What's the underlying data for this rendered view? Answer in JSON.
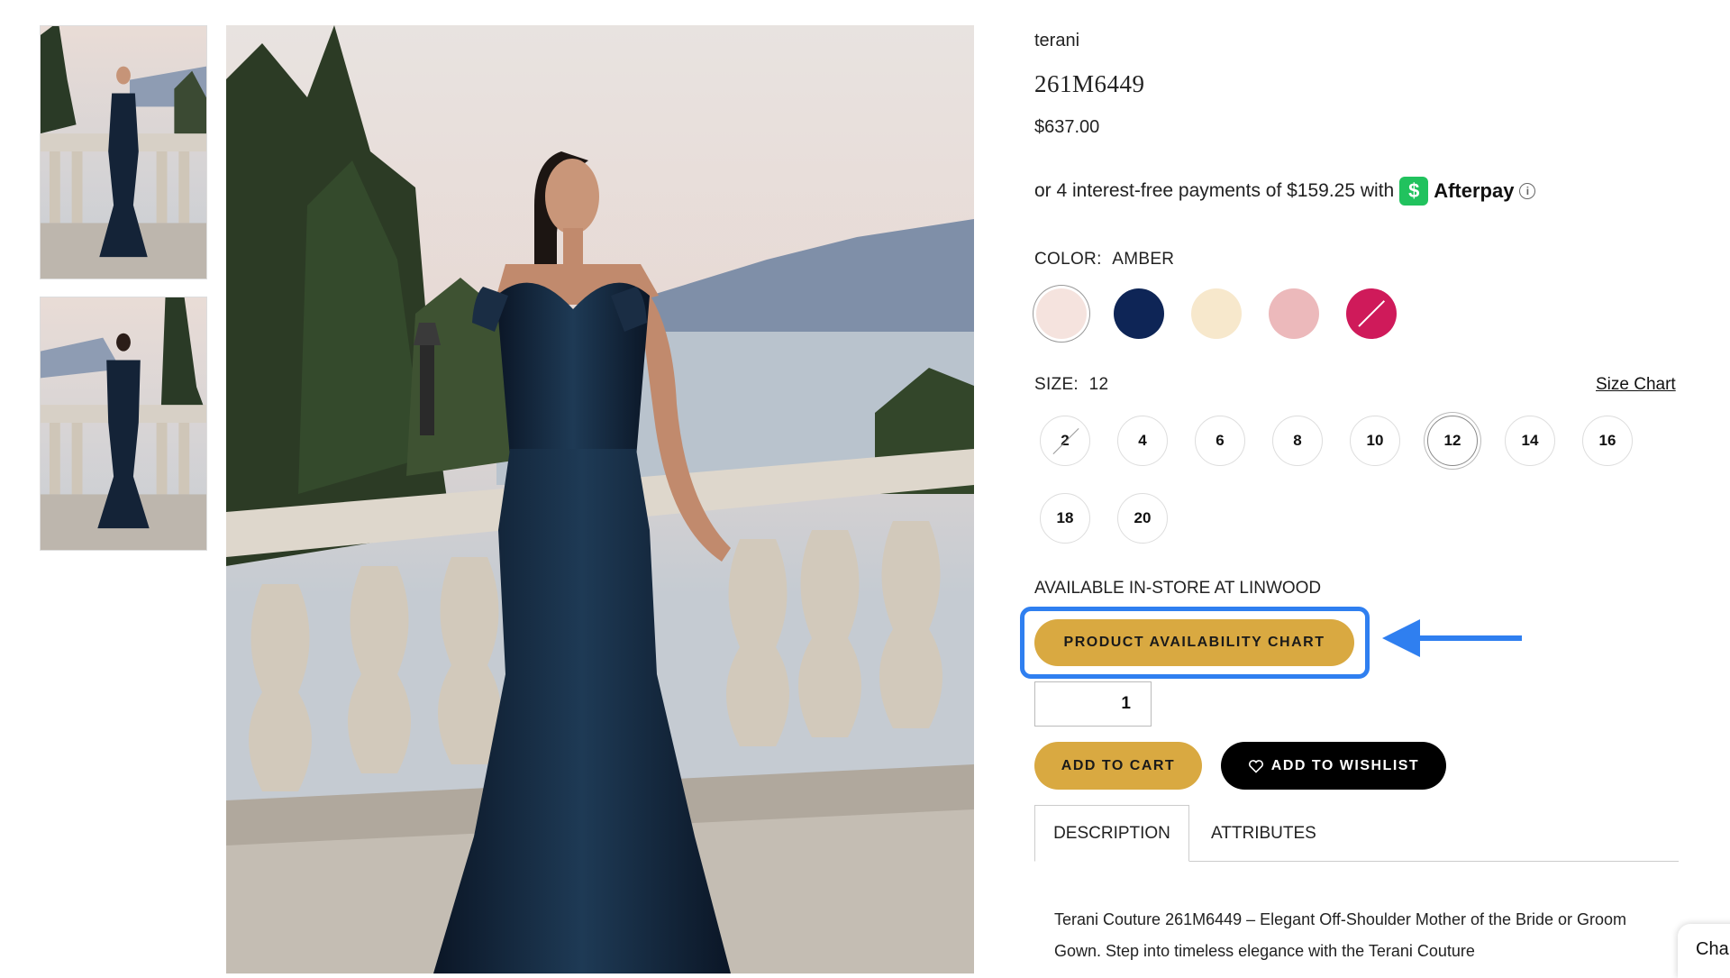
{
  "product": {
    "brand": "terani",
    "title": "261M6449",
    "price": "$637.00"
  },
  "afterpay": {
    "text": "or 4 interest-free payments of $159.25 with",
    "icon": "$",
    "brand": "Afterpay",
    "info_icon": "i"
  },
  "color": {
    "label": "COLOR:",
    "selected": "AMBER",
    "swatches": [
      {
        "name": "amber",
        "hex": "#f5e3de",
        "selected": true,
        "unavailable": false
      },
      {
        "name": "navy",
        "hex": "#0e2556",
        "selected": false,
        "unavailable": false
      },
      {
        "name": "cream",
        "hex": "#f7e8cc",
        "selected": false,
        "unavailable": false
      },
      {
        "name": "rose",
        "hex": "#ecb9bb",
        "selected": false,
        "unavailable": false
      },
      {
        "name": "magenta",
        "hex": "#cf1a5a",
        "selected": false,
        "unavailable": true
      }
    ]
  },
  "size": {
    "label": "SIZE:",
    "selected": "12",
    "size_chart": "Size Chart",
    "options": [
      {
        "label": "2",
        "unavailable": true,
        "selected": false
      },
      {
        "label": "4",
        "unavailable": false,
        "selected": false
      },
      {
        "label": "6",
        "unavailable": false,
        "selected": false
      },
      {
        "label": "8",
        "unavailable": false,
        "selected": false
      },
      {
        "label": "10",
        "unavailable": false,
        "selected": false
      },
      {
        "label": "12",
        "unavailable": false,
        "selected": true
      },
      {
        "label": "14",
        "unavailable": false,
        "selected": false
      },
      {
        "label": "16",
        "unavailable": false,
        "selected": false
      },
      {
        "label": "18",
        "unavailable": false,
        "selected": false
      },
      {
        "label": "20",
        "unavailable": false,
        "selected": false
      }
    ]
  },
  "availability": {
    "text": "AVAILABLE IN-STORE AT LINWOOD",
    "button": "PRODUCT AVAILABILITY CHART"
  },
  "cart": {
    "quantity": "1",
    "add_to_cart": "ADD TO CART",
    "add_to_wishlist": "ADD TO WISHLIST"
  },
  "tabs": [
    {
      "label": "DESCRIPTION",
      "active": true
    },
    {
      "label": "ATTRIBUTES",
      "active": false
    }
  ],
  "description": "Terani Couture 261M6449 – Elegant Off-Shoulder Mother of the Bride or Groom Gown. Step into timeless elegance with the Terani Couture",
  "chat": "Cha",
  "colors": {
    "gold": "#d9a941",
    "highlight": "#2f7ff0",
    "afterpay_green": "#21c25e"
  }
}
